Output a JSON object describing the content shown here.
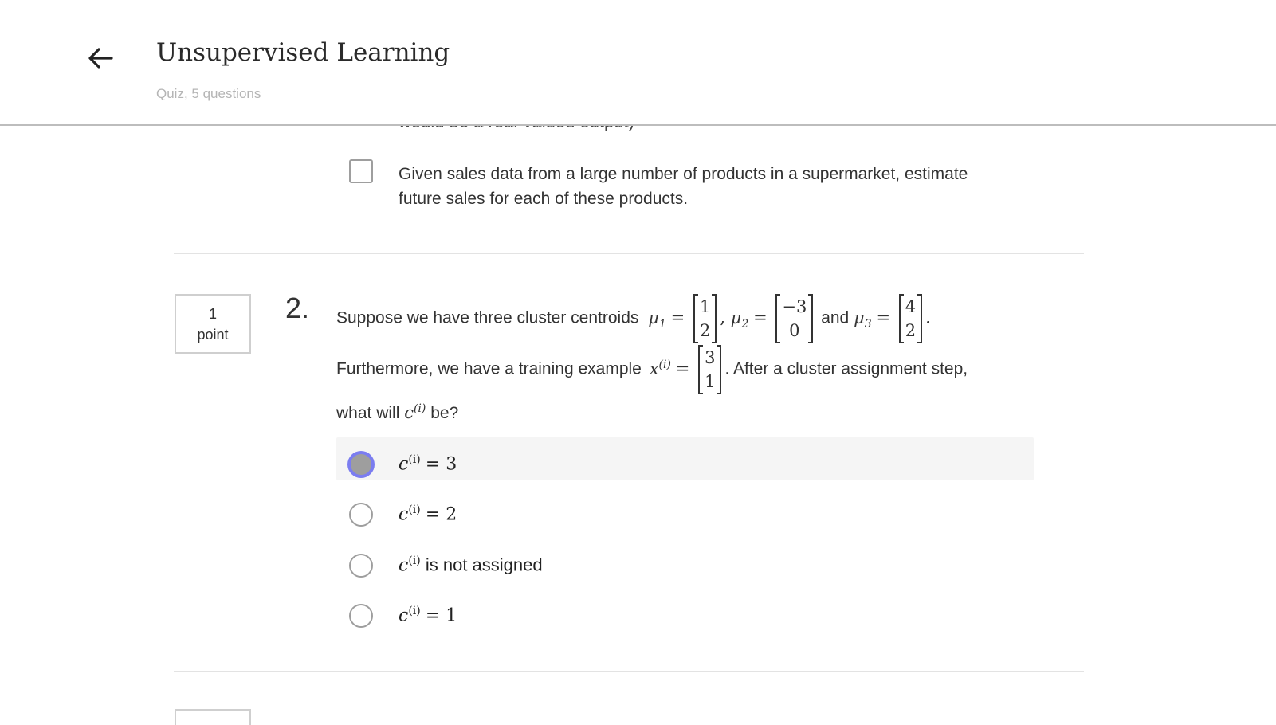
{
  "header": {
    "title": "Unsupervised Learning",
    "subtitle": "Quiz, 5 questions"
  },
  "prev_question": {
    "clipped_text": "would be a real-valued output)",
    "option_line1": "Given sales data from a large number of products in a supermarket, estimate",
    "option_line2": "future sales for each of these products."
  },
  "question2": {
    "points_value": "1",
    "points_label": "point",
    "number": "2.",
    "text_part1": "Suppose we have three cluster centroids",
    "mu1_symbol": "μ",
    "mu1_sub": "1",
    "mu1": [
      "1",
      "2"
    ],
    "mu2_symbol": "μ",
    "mu2_sub": "2",
    "mu2": [
      "−3",
      "0"
    ],
    "and_text": "and",
    "mu3_symbol": "μ",
    "mu3_sub": "3",
    "mu3": [
      "4",
      "2"
    ],
    "text_part2": "Furthermore, we have a training example",
    "x_symbol": "x",
    "x_sup": "(i)",
    "x_vec": [
      "3",
      "1"
    ],
    "text_part3": ". After a cluster assignment step,",
    "text_part4": "what will",
    "c_symbol": "c",
    "c_sup": "(i)",
    "text_part5": "be?",
    "options": [
      {
        "symbol": "c",
        "sup": "(i)",
        "rest": "= 3",
        "selected": true
      },
      {
        "symbol": "c",
        "sup": "(i)",
        "rest": "= 2",
        "selected": false
      },
      {
        "symbol": "c",
        "sup": "(i)",
        "rest": "is not assigned",
        "selected": false
      },
      {
        "symbol": "c",
        "sup": "(i)",
        "rest": "= 1",
        "selected": false
      }
    ]
  }
}
